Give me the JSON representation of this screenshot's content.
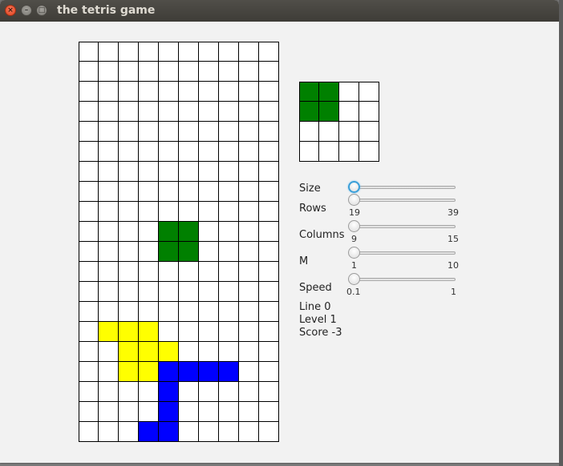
{
  "window": {
    "title": "the tetris game"
  },
  "colors": {
    "green": "#008000",
    "yellow": "#ffff00",
    "blue": "#0000ff",
    "empty": "#ffffff"
  },
  "board": {
    "columns": 10,
    "rows": 20,
    "cells": [
      {
        "row": 9,
        "col": 4,
        "color": "green"
      },
      {
        "row": 9,
        "col": 5,
        "color": "green"
      },
      {
        "row": 10,
        "col": 4,
        "color": "green"
      },
      {
        "row": 10,
        "col": 5,
        "color": "green"
      },
      {
        "row": 14,
        "col": 1,
        "color": "yellow"
      },
      {
        "row": 14,
        "col": 2,
        "color": "yellow"
      },
      {
        "row": 14,
        "col": 3,
        "color": "yellow"
      },
      {
        "row": 15,
        "col": 2,
        "color": "yellow"
      },
      {
        "row": 15,
        "col": 3,
        "color": "yellow"
      },
      {
        "row": 15,
        "col": 4,
        "color": "yellow"
      },
      {
        "row": 16,
        "col": 2,
        "color": "yellow"
      },
      {
        "row": 16,
        "col": 3,
        "color": "yellow"
      },
      {
        "row": 16,
        "col": 4,
        "color": "blue"
      },
      {
        "row": 16,
        "col": 5,
        "color": "blue"
      },
      {
        "row": 16,
        "col": 6,
        "color": "blue"
      },
      {
        "row": 16,
        "col": 7,
        "color": "blue"
      },
      {
        "row": 17,
        "col": 4,
        "color": "blue"
      },
      {
        "row": 18,
        "col": 4,
        "color": "blue"
      },
      {
        "row": 19,
        "col": 3,
        "color": "blue"
      },
      {
        "row": 19,
        "col": 4,
        "color": "blue"
      }
    ]
  },
  "preview": {
    "columns": 4,
    "rows": 4,
    "cells": [
      {
        "row": 0,
        "col": 0,
        "color": "green"
      },
      {
        "row": 0,
        "col": 1,
        "color": "green"
      },
      {
        "row": 1,
        "col": 0,
        "color": "green"
      },
      {
        "row": 1,
        "col": 1,
        "color": "green"
      }
    ]
  },
  "controls": {
    "size": {
      "label": "Size",
      "value_fraction": 0
    },
    "rows": {
      "label": "Rows",
      "min": "19",
      "max": "39",
      "value_fraction": 0
    },
    "columns": {
      "label": "Columns",
      "min": "9",
      "max": "15",
      "value_fraction": 0
    },
    "m": {
      "label": "M",
      "min": "1",
      "max": "10",
      "value_fraction": 0
    },
    "speed": {
      "label": "Speed",
      "min": "0.1",
      "max": "1",
      "value_fraction": 0
    }
  },
  "stats": {
    "line": "Line 0",
    "level": "Level 1",
    "score": "Score -3"
  }
}
